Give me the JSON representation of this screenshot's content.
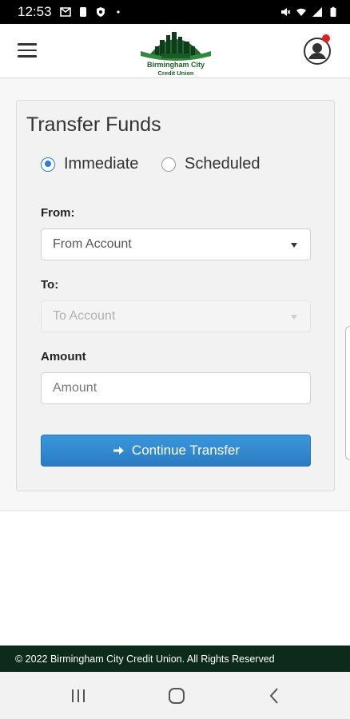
{
  "status_bar": {
    "time": "12:53",
    "left_icons": [
      "gmail-icon",
      "person-icon",
      "shield-icon",
      "dot-icon"
    ],
    "right_icons": [
      "mute-icon",
      "wifi-icon",
      "signal-icon",
      "battery-icon"
    ]
  },
  "header": {
    "logo": {
      "name": "Birmingham City",
      "sub": "Credit Union"
    }
  },
  "transfer": {
    "title": "Transfer Funds",
    "options": [
      {
        "label": "Immediate",
        "selected": true
      },
      {
        "label": "Scheduled",
        "selected": false
      }
    ],
    "from": {
      "label": "From:",
      "value": "From Account"
    },
    "to": {
      "label": "To:",
      "value": "To Account",
      "disabled": true
    },
    "amount": {
      "label": "Amount",
      "placeholder": "Amount",
      "value": ""
    },
    "continue_label": "Continue Transfer"
  },
  "footer": {
    "text": "© 2022 Birmingham City Credit Union. All Rights Reserved"
  },
  "nav": [
    "recents-icon",
    "home-icon",
    "back-icon"
  ],
  "colors": {
    "accent": "#2b7cc2",
    "footer_bg": "#0d2b1a",
    "brand_green": "#1d5a2a",
    "notification": "#e02020"
  }
}
